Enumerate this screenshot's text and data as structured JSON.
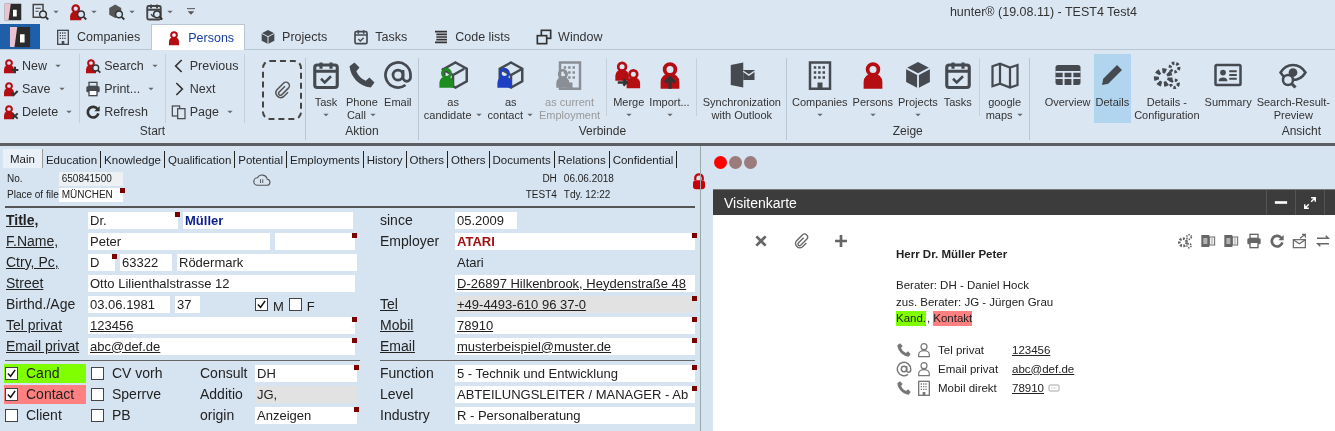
{
  "title_bar": {
    "title": "hunter® (19.08.11) - TEST4 Test4"
  },
  "app_tabs": [
    {
      "label": "Companies",
      "selected": false
    },
    {
      "label": "Persons",
      "selected": true
    },
    {
      "label": "Projects",
      "selected": false
    },
    {
      "label": "Tasks",
      "selected": false
    },
    {
      "label": "Code lists",
      "selected": false
    },
    {
      "label": "Window",
      "selected": false
    }
  ],
  "ribbon": [
    {
      "label": "Start",
      "small_columns": [
        [
          {
            "label": "New",
            "dropdown": true
          },
          {
            "label": "Save",
            "dropdown": true
          },
          {
            "label": "Delete",
            "dropdown": true
          }
        ],
        [
          {
            "label": "Search",
            "dropdown": true
          },
          {
            "label": "Print...",
            "dropdown": true
          },
          {
            "label": "Refresh",
            "dropdown": false
          }
        ],
        [
          {
            "label": "Previous",
            "dropdown": false
          },
          {
            "label": "Next",
            "dropdown": false
          },
          {
            "label": "Page",
            "dropdown": true
          }
        ]
      ],
      "buttons": [
        {
          "kind": "dropzone"
        }
      ]
    },
    {
      "label": "Aktion",
      "buttons": [
        {
          "kind": "large",
          "label": "Task",
          "dropdown": true
        },
        {
          "kind": "large",
          "label": "Phone\nCall",
          "dropdown": true
        },
        {
          "kind": "large",
          "label": "Email",
          "dropdown": false
        }
      ]
    },
    {
      "label": "Verbinde",
      "buttons": [
        {
          "kind": "large",
          "label": "as\ncandidate",
          "dropdown": true,
          "disabled": false
        },
        {
          "kind": "large",
          "label": "as\ncontact",
          "dropdown": true,
          "disabled": false
        },
        {
          "kind": "large",
          "label": "as current\nEmployment",
          "dropdown": false,
          "disabled": true
        },
        {
          "kind": "large",
          "label": "Merge",
          "dropdown": true,
          "disabled": false
        },
        {
          "kind": "large",
          "label": "Import...",
          "dropdown": true,
          "disabled": false
        },
        {
          "kind": "large",
          "label": "Synchronization\nwith Outlook",
          "dropdown": false,
          "disabled": false
        }
      ]
    },
    {
      "label": "Zeige",
      "buttons": [
        {
          "kind": "large",
          "label": "Companies",
          "dropdown": true
        },
        {
          "kind": "large",
          "label": "Persons",
          "dropdown": true
        },
        {
          "kind": "large",
          "label": "Projects",
          "dropdown": true
        },
        {
          "kind": "large",
          "label": "Tasks",
          "dropdown": false
        },
        {
          "kind": "large",
          "label": "google\nmaps",
          "dropdown": true
        }
      ]
    },
    {
      "label": "Ansicht",
      "buttons": [
        {
          "kind": "large",
          "label": "Overview",
          "dropdown": false,
          "selected": false
        },
        {
          "kind": "large",
          "label": "Details",
          "dropdown": false,
          "selected": true
        },
        {
          "kind": "large",
          "label": "Details -\nConfiguration",
          "dropdown": false,
          "selected": false
        },
        {
          "kind": "large",
          "label": "Summary",
          "dropdown": false,
          "selected": false
        },
        {
          "kind": "large",
          "label": "Search-Result-\nPreview",
          "dropdown": false,
          "selected": false
        }
      ]
    }
  ],
  "form_tabs": [
    {
      "label": "Main",
      "selected": true
    },
    {
      "label": "Education",
      "selected": false
    },
    {
      "label": "Knowledge",
      "selected": false
    },
    {
      "label": "Qualification",
      "selected": false
    },
    {
      "label": "Potential",
      "selected": false
    },
    {
      "label": "Employments",
      "selected": false
    },
    {
      "label": "History",
      "selected": false
    },
    {
      "label": "Others",
      "selected": false
    },
    {
      "label": "Others",
      "selected": false
    },
    {
      "label": "Documents",
      "selected": false
    },
    {
      "label": "Relations",
      "selected": false
    },
    {
      "label": "Confidential",
      "selected": false
    }
  ],
  "record": {
    "no_label": "No.",
    "no_value": "650841500",
    "place_label": "Place of file",
    "place_value": "MÜNCHEN",
    "place_marker": true,
    "created_by": "DH",
    "created_date": "06.06.2018",
    "changed_by": "TEST4",
    "changed_time": "Tdy. 12:22"
  },
  "left_fields": [
    {
      "label": "Title,",
      "link": true,
      "bold": true,
      "fields": [
        {
          "value": "Dr.",
          "kind": "text",
          "readonly": false,
          "marker": true
        },
        {
          "value": "Müller",
          "kind": "name",
          "readonly": false,
          "marker": false
        }
      ]
    },
    {
      "label": "F.Name,",
      "link": true,
      "bold": false,
      "fields": [
        {
          "value": "Peter",
          "kind": "text",
          "readonly": false,
          "marker": false
        },
        {
          "kind": "text",
          "readonly": false,
          "marker": true
        }
      ]
    },
    {
      "label": "Ctry, Pc,",
      "link": true,
      "bold": false,
      "fields": [
        {
          "value": "D",
          "kind": "text",
          "readonly": false,
          "marker": true
        },
        {
          "value": "63322",
          "kind": "text",
          "readonly": false,
          "marker": false
        },
        {
          "value": "Rödermark",
          "kind": "text",
          "readonly": false,
          "marker": false
        }
      ]
    },
    {
      "label": "Street",
      "link": true,
      "bold": false,
      "fields": [
        {
          "value": "Otto Lilienthalstrasse 12",
          "kind": "text",
          "readonly": false,
          "marker": false
        }
      ]
    },
    {
      "label": "Birthd./Age",
      "link": false,
      "bold": false,
      "fields": [
        {
          "value": "03.06.1981",
          "kind": "text",
          "readonly": false,
          "marker": false
        },
        {
          "value": "37",
          "kind": "text",
          "readonly": false,
          "marker": false
        }
      ],
      "genders": [
        {
          "label": "M",
          "checked": true
        },
        {
          "label": "F",
          "checked": false
        }
      ]
    },
    {
      "label": "Tel privat",
      "link": true,
      "bold": false,
      "fields": [
        {
          "value": "123456",
          "kind": "link",
          "readonly": false,
          "marker": true
        }
      ]
    },
    {
      "label": "Email privat",
      "link": true,
      "bold": false,
      "fields": [
        {
          "value": "abc@def.de",
          "kind": "link",
          "readonly": false,
          "marker": true
        }
      ]
    }
  ],
  "right_fields": [
    {
      "label": "since",
      "link": false,
      "fields": [
        {
          "value": "05.2009",
          "kind": "text",
          "readonly": false,
          "marker": false
        }
      ]
    },
    {
      "label": "Employer",
      "link": false,
      "fields": [
        {
          "value": "ATARI",
          "kind": "employer",
          "readonly": false,
          "marker": true
        }
      ]
    },
    {
      "fields": [
        {
          "value": "Atari",
          "kind": "plain",
          "readonly": false,
          "marker": false
        }
      ]
    },
    {
      "fields": [
        {
          "value": "D-26897 Hilkenbrook, Heydenstraße 48",
          "kind": "link",
          "readonly": false,
          "marker": false
        }
      ]
    },
    {
      "label": "Tel",
      "link": true,
      "fields": [
        {
          "value": "+49-4493-610 96 37-0",
          "kind": "link",
          "readonly": true,
          "marker": true
        }
      ]
    },
    {
      "label": "Mobil",
      "link": true,
      "fields": [
        {
          "value": "78910",
          "kind": "link",
          "readonly": false,
          "marker": true
        }
      ]
    },
    {
      "label": "Email",
      "link": true,
      "fields": [
        {
          "value": "musterbeispiel@muster.de",
          "kind": "link",
          "readonly": false,
          "marker": true
        }
      ]
    }
  ],
  "flags": [
    {
      "label": "Cand",
      "checked": true,
      "color": "#80ff00"
    },
    {
      "label": "Contact",
      "checked": true,
      "color": "#ff8080"
    },
    {
      "label": "Client",
      "checked": false
    }
  ],
  "options": [
    {
      "label": "CV vorh",
      "checked": false
    },
    {
      "label": "Sperrve",
      "checked": false
    },
    {
      "label": "PB",
      "checked": false
    }
  ],
  "assignment": [
    {
      "label": "Consult",
      "value": "DH",
      "readonly": false,
      "marker": true
    },
    {
      "label": "Additio",
      "value": "JG,",
      "readonly": true,
      "marker": false
    },
    {
      "label": "origin",
      "value": "Anzeigen",
      "readonly": false,
      "marker": true
    }
  ],
  "classification": [
    {
      "label": "Function",
      "value": "5 - Technik und Entwicklung",
      "marker": true
    },
    {
      "label": "Level",
      "value": "ABTEILUNGSLEITER / MANAGER - Ab",
      "marker": true
    },
    {
      "label": "Industry",
      "value": "R - Personalberatung",
      "marker": false
    }
  ],
  "status_dots": [
    {
      "color": "#ff0000"
    },
    {
      "color": "#9b7b7b"
    },
    {
      "color": "#9b7b7b"
    }
  ],
  "card": {
    "title": "Visitenkarte",
    "name": "Herr Dr. Müller Peter",
    "lines": [
      "Berater: DH - Daniel Hock",
      "zus. Berater: JG - Jürgen Grau"
    ],
    "tags": [
      {
        "label": "Kand.",
        "color": "#80ff00"
      },
      {
        "label": "Kontakt",
        "color": "#ff8080"
      }
    ],
    "tag_separator": ",",
    "contacts": [
      {
        "kind": "phone",
        "label": "Tel privat",
        "value": "123456",
        "sms": false
      },
      {
        "kind": "email",
        "label": "Email privat",
        "value": "abc@def.de",
        "sms": false
      },
      {
        "kind": "mobile",
        "label": "Mobil direkt",
        "value": "78910",
        "sms": true
      }
    ]
  }
}
